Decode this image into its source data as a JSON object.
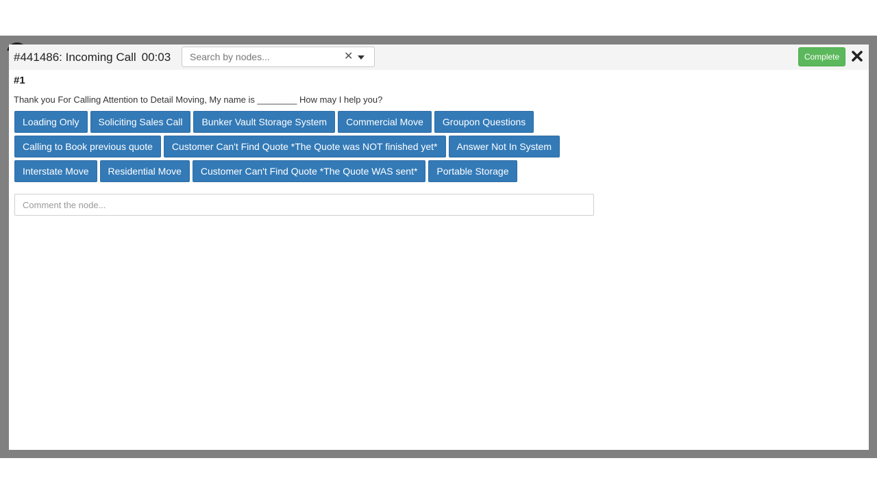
{
  "call": {
    "title": "#441486: Incoming Call",
    "timer": "00:03"
  },
  "search": {
    "placeholder": "Search by nodes...",
    "value": "",
    "clear_icon": "close-icon",
    "toggle_icon": "caret-down-icon"
  },
  "header": {
    "complete_label": "Complete",
    "close_icon": "close-icon"
  },
  "node": {
    "number": "#1",
    "script": "Thank you For Calling Attention to Detail Moving, My name is ________ How may I help you?"
  },
  "options": {
    "row1": [
      "Loading Only",
      "Soliciting Sales Call",
      "Bunker Vault Storage System",
      "Commercial Move",
      "Groupon Questions"
    ],
    "row2": [
      "Calling to Book previous quote",
      "Customer Can't Find Quote *The Quote was NOT finished yet*",
      "Answer Not In System"
    ],
    "row3": [
      "Interstate Move",
      "Residential Move",
      "Customer Can't Find Quote *The Quote WAS sent*",
      "Portable Storage"
    ]
  },
  "comment": {
    "placeholder": "Comment the node...",
    "value": ""
  },
  "colors": {
    "primary": "#337ab7",
    "success": "#5cb85c",
    "overlay": "#808080"
  }
}
